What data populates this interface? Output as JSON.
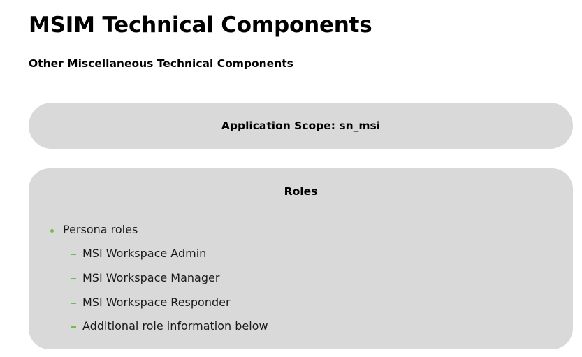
{
  "header": {
    "title": "MSIM Technical Components",
    "subtitle": "Other Miscellaneous Technical Components"
  },
  "scope": {
    "text": "Application Scope: sn_msi"
  },
  "roles": {
    "heading": "Roles",
    "group_label": "Persona roles",
    "items": [
      "MSI Workspace Admin",
      "MSI Workspace Manager",
      "MSI Workspace Responder",
      "Additional role information below"
    ]
  },
  "colors": {
    "panel_background": "#d9d9d9",
    "bullet": "#6cc04a",
    "text": "#000000"
  }
}
